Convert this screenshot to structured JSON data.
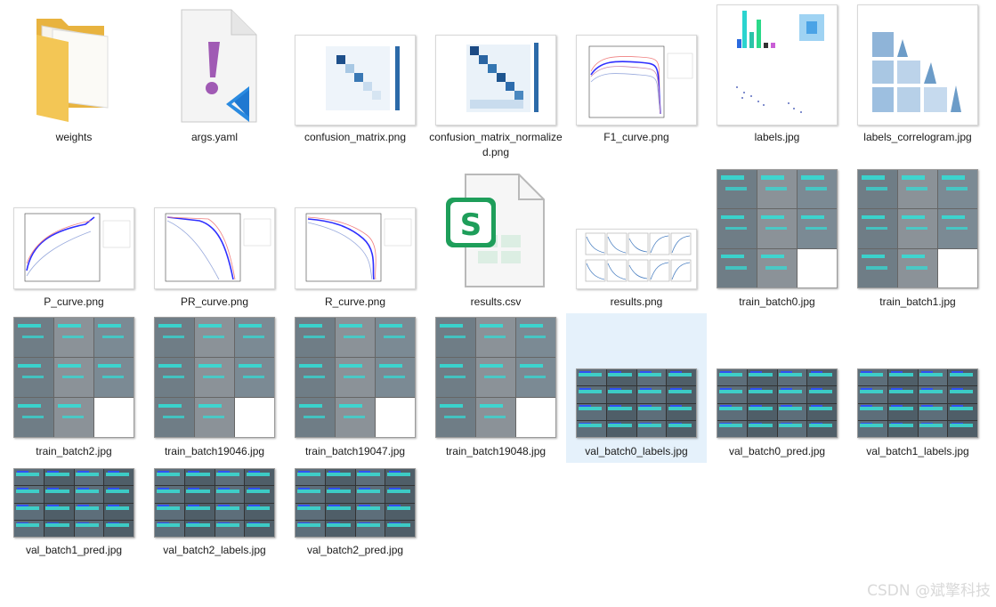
{
  "files": [
    {
      "name": "weights",
      "type": "folder"
    },
    {
      "name": "args.yaml",
      "type": "yaml",
      "icon": "vscode-yaml-icon"
    },
    {
      "name": "confusion_matrix.png",
      "type": "heatmap"
    },
    {
      "name": "confusion_matrix_normalized.png",
      "type": "heatmap"
    },
    {
      "name": "F1_curve.png",
      "type": "curve"
    },
    {
      "name": "labels.jpg",
      "type": "labels"
    },
    {
      "name": "labels_correlogram.jpg",
      "type": "correlogram"
    },
    {
      "name": "P_curve.png",
      "type": "curve"
    },
    {
      "name": "PR_curve.png",
      "type": "curve"
    },
    {
      "name": "R_curve.png",
      "type": "curve"
    },
    {
      "name": "results.csv",
      "type": "csv",
      "icon": "spreadsheet-icon"
    },
    {
      "name": "results.png",
      "type": "results"
    },
    {
      "name": "train_batch0.jpg",
      "type": "mosaic"
    },
    {
      "name": "train_batch1.jpg",
      "type": "mosaic"
    },
    {
      "name": "train_batch2.jpg",
      "type": "mosaic"
    },
    {
      "name": "train_batch19046.jpg",
      "type": "mosaic"
    },
    {
      "name": "train_batch19047.jpg",
      "type": "mosaic"
    },
    {
      "name": "train_batch19048.jpg",
      "type": "mosaic"
    },
    {
      "name": "val_batch0_labels.jpg",
      "type": "strip",
      "selected": true
    },
    {
      "name": "val_batch0_pred.jpg",
      "type": "strip"
    },
    {
      "name": "val_batch1_labels.jpg",
      "type": "strip"
    },
    {
      "name": "val_batch1_pred.jpg",
      "type": "strip"
    },
    {
      "name": "val_batch2_labels.jpg",
      "type": "strip"
    },
    {
      "name": "val_batch2_pred.jpg",
      "type": "strip"
    }
  ],
  "watermark": "CSDN @斌擎科技",
  "colors": {
    "folder": "#f3c655",
    "accent_cyan": "#31e0d8",
    "selection": "#e5f1fb",
    "csv_green": "#1e9e5a",
    "yaml_purple": "#a05ab4",
    "vscode_blue": "#1f78d1"
  }
}
